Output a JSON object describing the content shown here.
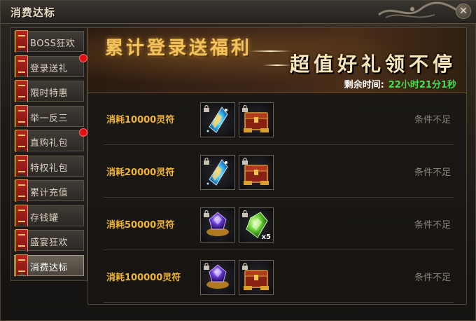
{
  "window": {
    "title": "消费达标"
  },
  "sidebar": {
    "items": [
      {
        "label": "BOSS狂欢",
        "badge": false,
        "active": false
      },
      {
        "label": "登录送礼",
        "badge": true,
        "active": false
      },
      {
        "label": "限时特惠",
        "badge": false,
        "active": false
      },
      {
        "label": "举一反三",
        "badge": false,
        "active": false
      },
      {
        "label": "直购礼包",
        "badge": true,
        "active": false
      },
      {
        "label": "特权礼包",
        "badge": false,
        "active": false
      },
      {
        "label": "累计充值",
        "badge": false,
        "active": false
      },
      {
        "label": "存钱罐",
        "badge": false,
        "active": false
      },
      {
        "label": "盛宴狂欢",
        "badge": false,
        "active": false
      },
      {
        "label": "消费达标",
        "badge": false,
        "active": true
      }
    ]
  },
  "banner": {
    "title": "累计登录送福利",
    "subtitle": "超值好礼领不停",
    "time_label": "剩余时间:",
    "time_value": "22小时21分1秒"
  },
  "tasks": [
    {
      "label": "消耗10000灵符",
      "status": "条件不足",
      "rewards": [
        {
          "icon": "blue-crystal-icon",
          "qty": ""
        },
        {
          "icon": "treasure-chest-icon",
          "qty": ""
        }
      ]
    },
    {
      "label": "消耗20000灵符",
      "status": "条件不足",
      "rewards": [
        {
          "icon": "blue-crystal-icon",
          "qty": ""
        },
        {
          "icon": "treasure-chest-icon",
          "qty": ""
        }
      ]
    },
    {
      "label": "消耗50000灵符",
      "status": "条件不足",
      "rewards": [
        {
          "icon": "purple-gem-icon",
          "qty": ""
        },
        {
          "icon": "green-gem-icon",
          "qty": "x5"
        }
      ]
    },
    {
      "label": "消耗100000灵符",
      "status": "条件不足",
      "rewards": [
        {
          "icon": "purple-gem-icon",
          "qty": ""
        },
        {
          "icon": "treasure-chest-icon",
          "qty": ""
        }
      ]
    }
  ],
  "colors": {
    "accent_gold": "#f2b533",
    "time_green": "#3ee04a",
    "badge_red": "#e01010",
    "status_gray": "#8a8478"
  }
}
